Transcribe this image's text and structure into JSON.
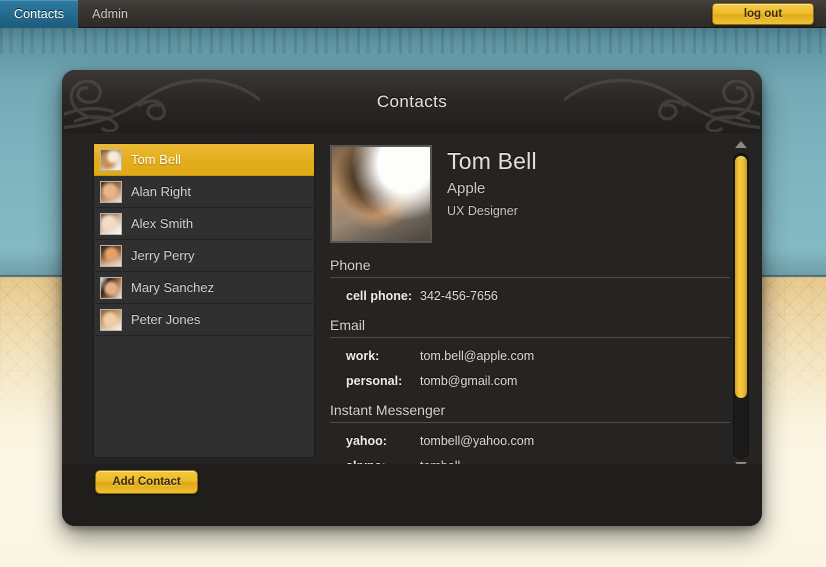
{
  "topbar": {
    "tabs": [
      {
        "label": "Contacts",
        "active": true
      },
      {
        "label": "Admin",
        "active": false
      }
    ],
    "logout_label": "log out"
  },
  "modal": {
    "title": "Contacts",
    "contacts": [
      {
        "name": "Tom Bell",
        "selected": true
      },
      {
        "name": "Alan Right",
        "selected": false
      },
      {
        "name": "Alex Smith",
        "selected": false
      },
      {
        "name": "Jerry Perry",
        "selected": false
      },
      {
        "name": "Mary Sanchez",
        "selected": false
      },
      {
        "name": "Peter Jones",
        "selected": false
      }
    ],
    "detail": {
      "name": "Tom Bell",
      "company": "Apple",
      "role": "UX Designer",
      "sections": [
        {
          "title": "Phone",
          "fields": [
            {
              "label": "cell phone:",
              "value": "342-456-7656"
            }
          ]
        },
        {
          "title": "Email",
          "fields": [
            {
              "label": "work:",
              "value": "tom.bell@apple.com"
            },
            {
              "label": "personal:",
              "value": "tomb@gmail.com"
            }
          ]
        },
        {
          "title": "Instant Messenger",
          "fields": [
            {
              "label": "yahoo:",
              "value": "tombell@yahoo.com"
            },
            {
              "label": "skype:",
              "value": "tombell"
            }
          ]
        }
      ]
    },
    "footer": {
      "add_contact_label": "Add Contact"
    },
    "scrollbar": {
      "up_icon": "triangle-up-icon",
      "down_icon": "triangle-down-icon"
    }
  },
  "colors": {
    "accent_gold": "#e3ad1d",
    "nav_active_blue": "#246d92",
    "modal_bg": "#262422",
    "page_cream": "#fbf6e3"
  }
}
